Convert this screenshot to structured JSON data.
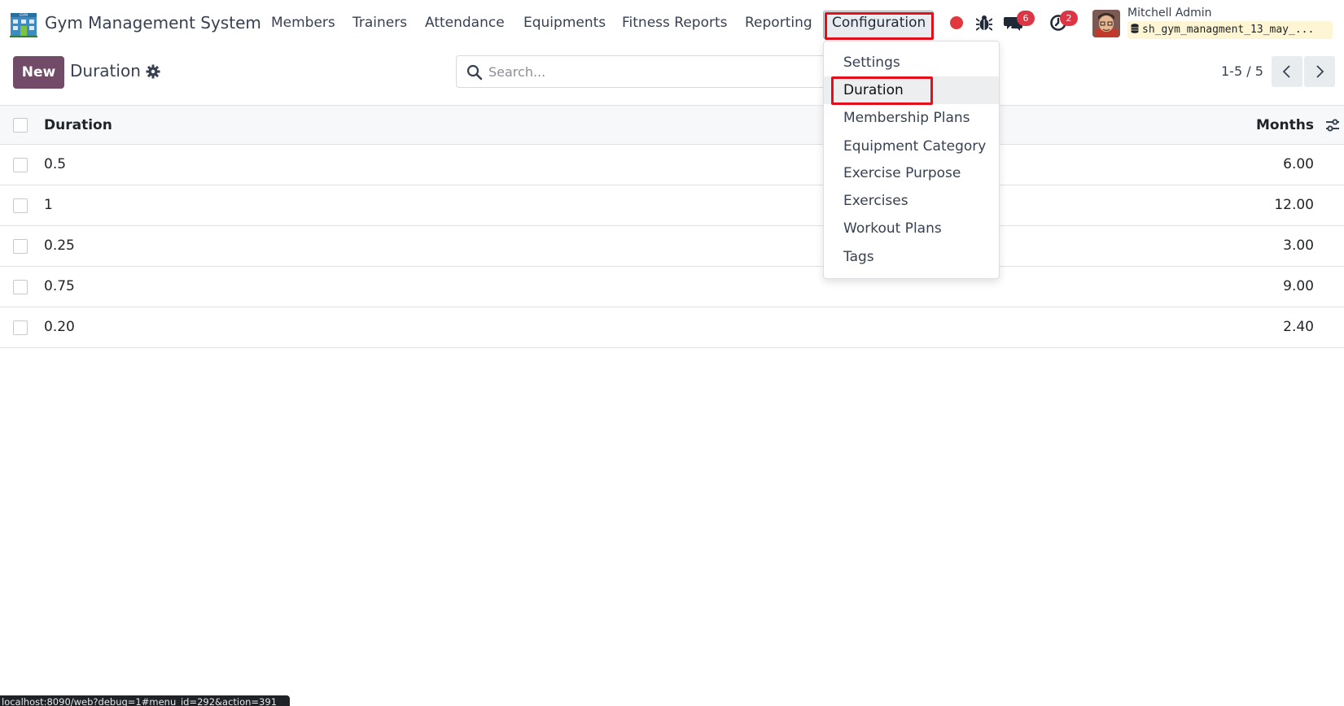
{
  "app": {
    "title": "Gym Management System",
    "logo_name": "gym-building-icon"
  },
  "nav": {
    "members": "Members",
    "trainers": "Trainers",
    "attendance": "Attendance",
    "equipments": "Equipments",
    "fitness_reports": "Fitness Reports",
    "reporting": "Reporting",
    "configuration": "Configuration"
  },
  "systray": {
    "messages_count": "6",
    "activities_count": "2",
    "user_name": "Mitchell Admin",
    "database": "sh_gym_managment_13_may_..."
  },
  "control_panel": {
    "new_label": "New",
    "title": "Duration",
    "search_placeholder": "Search...",
    "pager": "1-5 / 5"
  },
  "table": {
    "headers": {
      "duration": "Duration",
      "months": "Months"
    },
    "rows": [
      {
        "duration": "0.5",
        "months": "6.00"
      },
      {
        "duration": "1",
        "months": "12.00"
      },
      {
        "duration": "0.25",
        "months": "3.00"
      },
      {
        "duration": "0.75",
        "months": "9.00"
      },
      {
        "duration": "0.20",
        "months": "2.40"
      }
    ]
  },
  "dropdown": {
    "items": [
      {
        "label": "Settings"
      },
      {
        "label": "Duration",
        "active": true
      },
      {
        "label": "Membership Plans"
      },
      {
        "label": "Equipment Category"
      },
      {
        "label": "Exercise Purpose"
      },
      {
        "label": "Exercises"
      },
      {
        "label": "Workout Plans"
      },
      {
        "label": "Tags"
      }
    ]
  },
  "status_url": "localhost:8090/web?debug=1#menu_id=292&action=391",
  "colors": {
    "brand": "#714b67",
    "highlight": "#e3101c",
    "badge": "#dc3545"
  }
}
